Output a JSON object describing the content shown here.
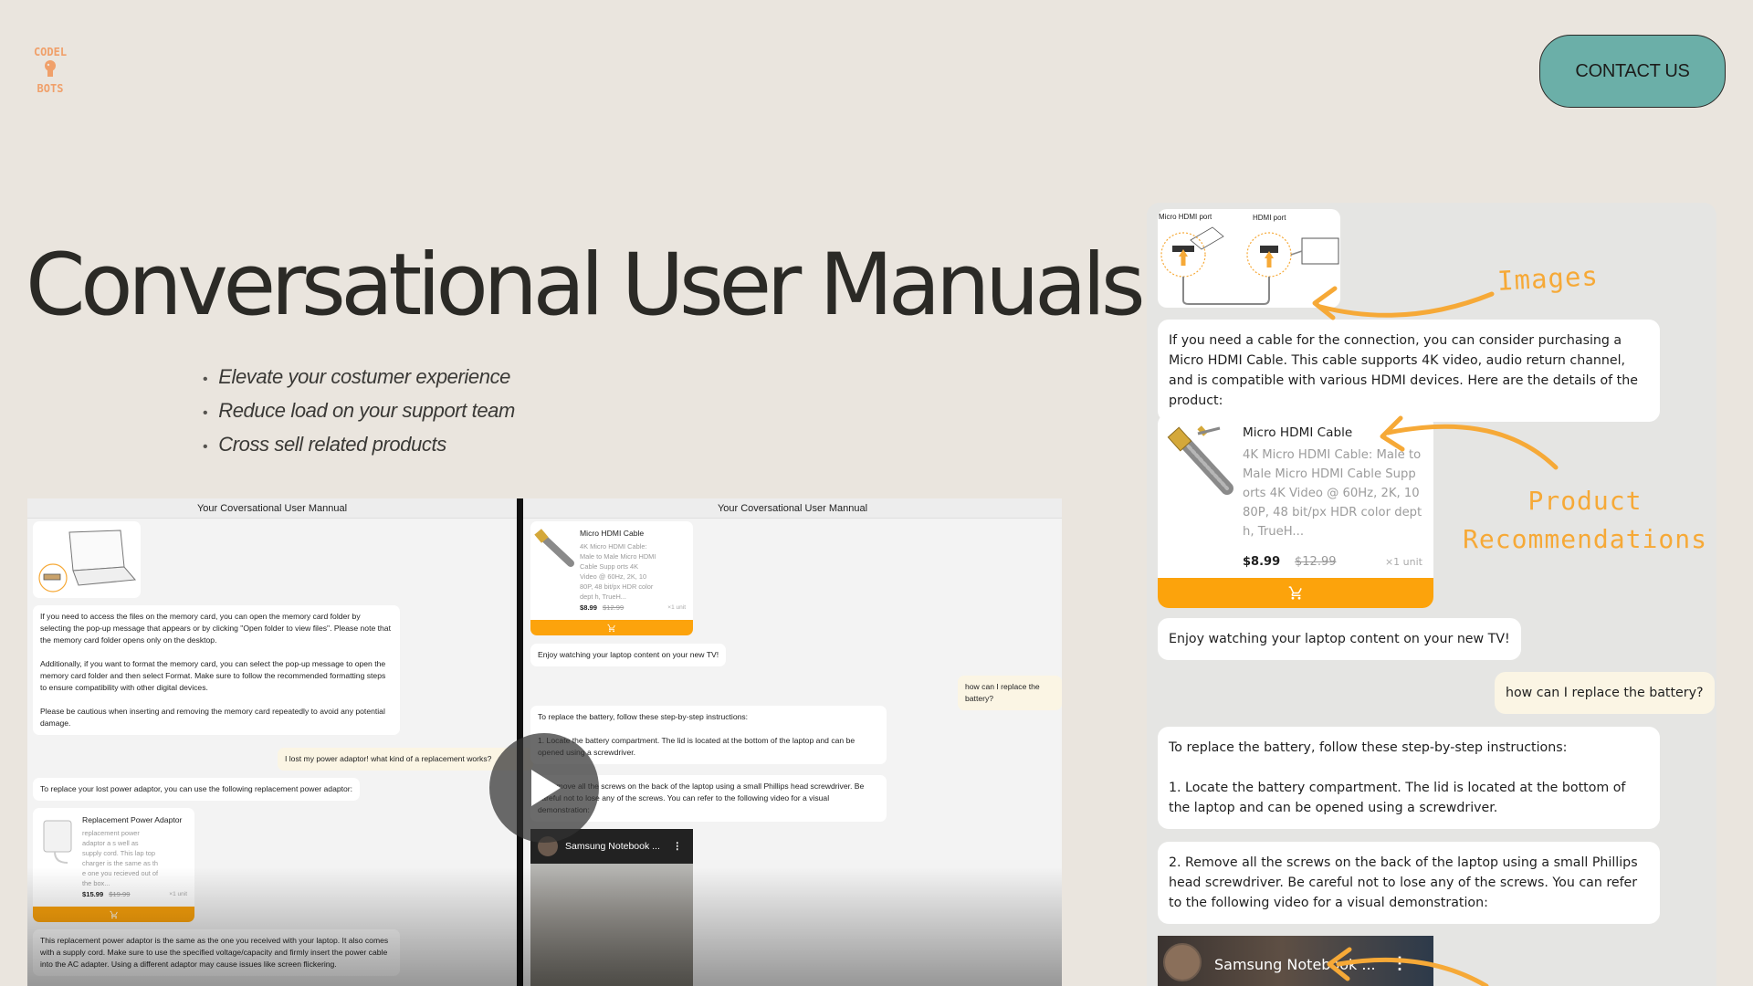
{
  "brand": {
    "logo_top": "CODEL",
    "logo_bottom": "BOTS"
  },
  "header": {
    "contact_label": "CONTACT US"
  },
  "hero": {
    "title": "Conversational User Manuals",
    "bullets": [
      "Elevate your costumer experience",
      "Reduce load on your support team",
      "Cross sell related products"
    ]
  },
  "video": {
    "left": {
      "header": "Your Coversational User Mannual",
      "msg1": [
        "If you need to access the files on the memory card, you can open the memory card folder by selecting the pop-up message that appears or by clicking \"Open folder to view files\". Please note that the memory card folder opens only on the desktop.",
        "Additionally, if you want to format the memory card, you can select the pop-up message to open the memory card folder and then select Format. Make sure to follow the recommended formatting steps to ensure compatibility with other digital devices.",
        "Please be cautious when inserting and removing the memory card repeatedly to avoid any potential damage."
      ],
      "user_msg": "I lost my power adaptor! what kind of a replacement works?",
      "msg2": "To replace your lost power adaptor, you can use the following replacement power adaptor:",
      "product": {
        "title": "Replacement Power Adaptor",
        "desc": "replacement power adaptor a s well as supply cord. This lap top charger is the same as th e one you recieved out of the box...",
        "price": "$15.99",
        "old_price": "$19.99",
        "unit": "×1 unit"
      },
      "msg3": "This replacement power adaptor is the same as the one you received with your laptop. It also comes with a supply cord. Make sure to use the specified voltage/capacity and firmly insert the power cable into the AC adapter. Using a different adaptor may cause issues like screen flickering."
    },
    "right": {
      "header": "Your Coversational User Mannual",
      "product": {
        "title": "Micro HDMI Cable",
        "desc": "4K Micro HDMI Cable: Male to Male Micro HDMI Cable Supp orts 4K Video @ 60Hz, 2K, 10 80P, 48 bit/px HDR color dept h, TrueH...",
        "price": "$8.99",
        "old_price": "$12.99",
        "unit": "×1 unit"
      },
      "msg1": "Enjoy watching your laptop content on your new TV!",
      "user_msg": "how can I replace the battery?",
      "msg2": "To replace the battery, follow these step-by-step instructions:",
      "msg3": "1. Locate the battery compartment. The lid is located at the bottom of the laptop and can be opened using a screwdriver.",
      "msg4": "2. Remove all the screws on the back of the laptop using a small Phillips head screwdriver. Be careful not to lose any of the screws. You can refer to the following video for a visual demonstration:",
      "yt_title": "Samsung Notebook ..."
    }
  },
  "chat": {
    "diagram": {
      "label_left": "Micro HDMI port",
      "label_right": "HDMI port"
    },
    "msg1": "If you need a cable for the connection, you can consider purchasing a Micro HDMI Cable. This cable supports 4K video, audio return channel, and is compatible with various HDMI devices. Here are the details of the product:",
    "product": {
      "title": "Micro HDMI Cable",
      "desc": "4K Micro HDMI Cable: Male to Male Micro HDMI Cable Supp orts 4K Video @ 60Hz, 2K, 10 80P, 48 bit/px HDR color dept h, TrueH...",
      "price": "$8.99",
      "old_price": "$12.99",
      "unit": "×1 unit"
    },
    "msg2": "Enjoy watching your laptop content on your new TV!",
    "user_msg": "how can I replace the battery?",
    "msg3": [
      "To replace the battery, follow these step-by-step instructions:",
      "1. Locate the battery compartment. The lid is located at the bottom of the laptop and can be opened using a screwdriver."
    ],
    "msg4": "2. Remove all the screws on the back of the laptop using a small Phillips head screwdriver. Be careful not to lose any of the screws. You can refer to the following video for a visual demonstration:",
    "yt_title": "Samsung Notebook ..."
  },
  "annotations": {
    "images": "Images",
    "rec_line1": "Product",
    "rec_line2": "Recommendations"
  },
  "colors": {
    "background": "#EAE5DE",
    "accent_teal": "#6BAFA8",
    "cart_orange": "#FCA30C",
    "annotation_orange": "#F6A937",
    "user_bubble": "#FBF5E4"
  },
  "icons": [
    "cart-icon",
    "play-icon",
    "more-vert-icon"
  ]
}
